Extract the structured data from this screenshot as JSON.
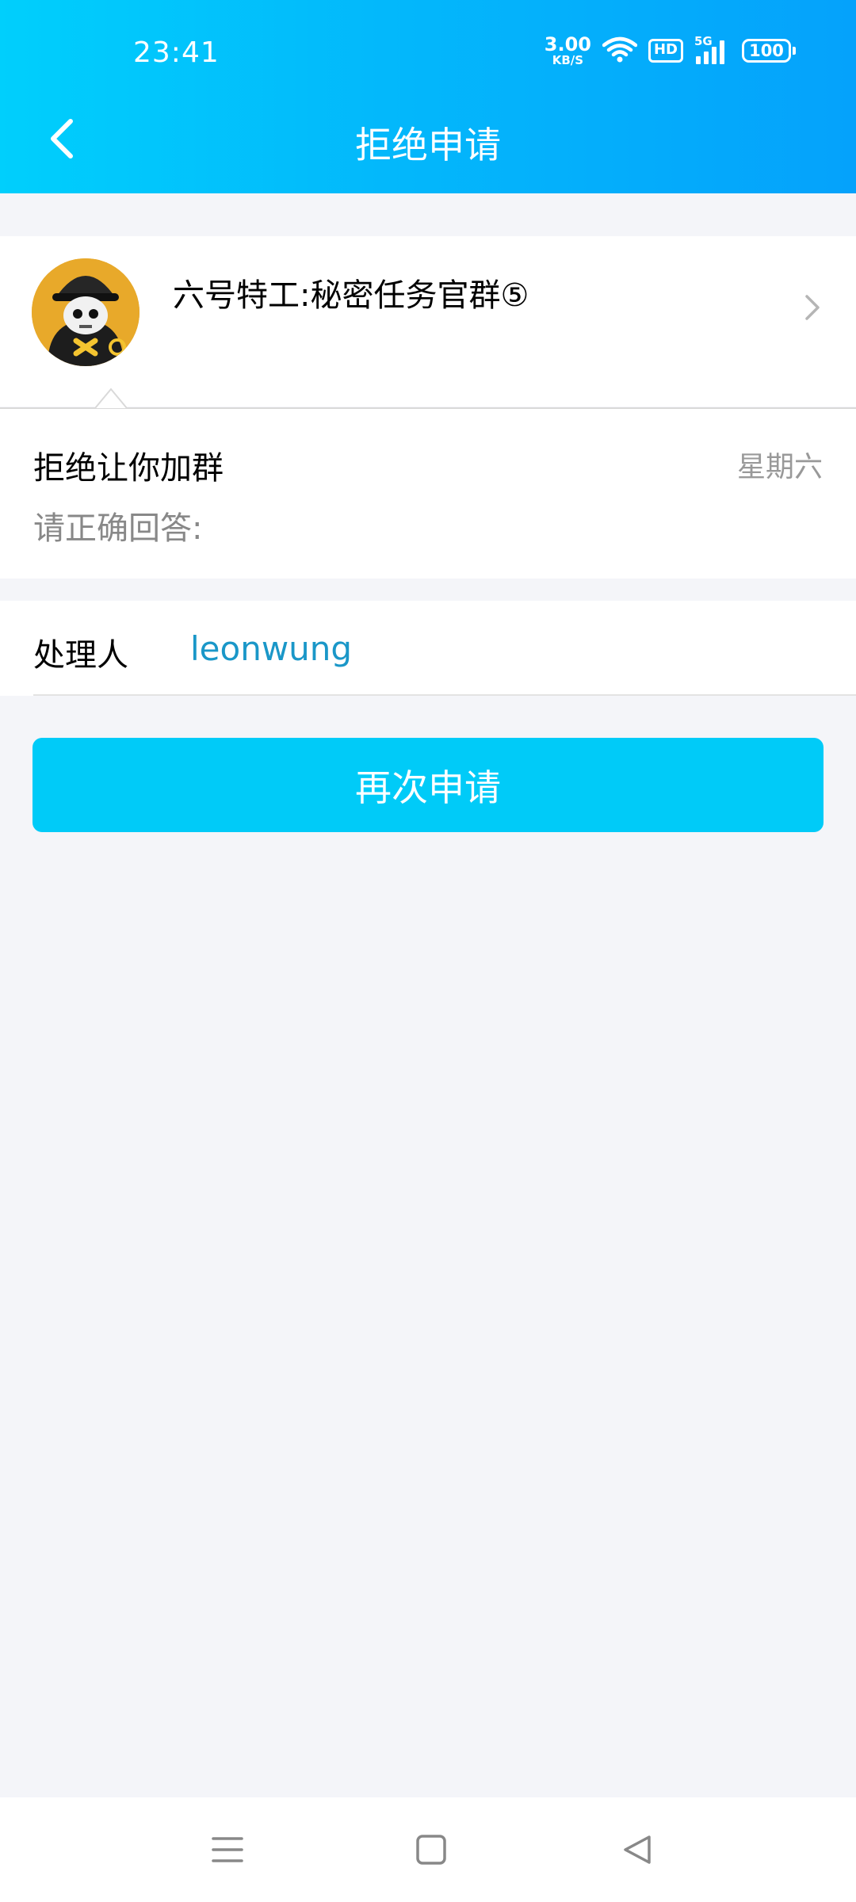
{
  "status_bar": {
    "time": "23:41",
    "net_speed_value": "3.00",
    "net_speed_unit": "KB/S",
    "hd_label": "HD",
    "signal_label": "5G",
    "battery": "100"
  },
  "header": {
    "title": "拒绝申请",
    "back_icon": "chevron-left-icon"
  },
  "group": {
    "name": "六号特工:秘密任务官群⑤"
  },
  "message": {
    "title": "拒绝让你加群",
    "date": "星期六",
    "note": "请正确回答:"
  },
  "handler": {
    "label": "处理人",
    "value": "leonwung"
  },
  "actions": {
    "reapply_label": "再次申请"
  },
  "colors": {
    "header_start": "#00cffc",
    "header_end": "#05a2fb",
    "button": "#00cbf8",
    "handler_link": "#1a97c8",
    "page_bg": "#f4f5f9"
  }
}
